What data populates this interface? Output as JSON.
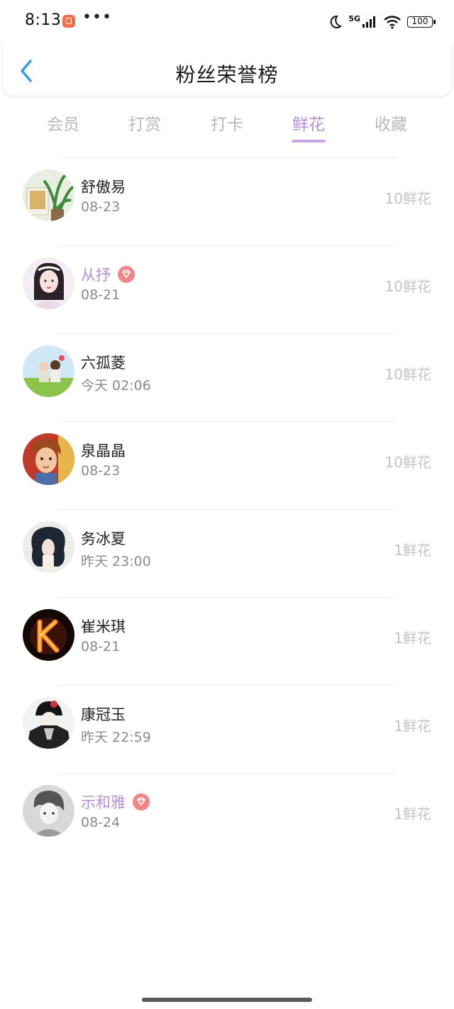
{
  "status_bar": {
    "time": "8:13",
    "dots": "•••",
    "network": "5G",
    "battery": "100"
  },
  "header": {
    "title": "粉丝荣誉榜"
  },
  "tabs": [
    {
      "label": "会员",
      "active": false
    },
    {
      "label": "打赏",
      "active": false
    },
    {
      "label": "打卡",
      "active": false
    },
    {
      "label": "鲜花",
      "active": true
    },
    {
      "label": "收藏",
      "active": false
    }
  ],
  "colors": {
    "accent": "#b98fd3",
    "vip_badge": "#f1858a",
    "muted": "#c4c4c4"
  },
  "list": [
    {
      "name": "舒傲易",
      "date": "08-23",
      "amount": "10鲜花",
      "vip": false,
      "avatar": "plant-photo-avatar"
    },
    {
      "name": "从抒",
      "date": "08-21",
      "amount": "10鲜花",
      "vip": true,
      "avatar": "anime-girl-avatar"
    },
    {
      "name": "六孤菱",
      "date": "今天 02:06",
      "amount": "10鲜花",
      "vip": false,
      "avatar": "couple-on-grass-avatar"
    },
    {
      "name": "泉晶晶",
      "date": "08-23",
      "amount": "10鲜花",
      "vip": false,
      "avatar": "cartoon-boy-avatar"
    },
    {
      "name": "务冰夏",
      "date": "昨天 23:00",
      "amount": "1鲜花",
      "vip": false,
      "avatar": "curly-hair-avatar"
    },
    {
      "name": "崔米琪",
      "date": "08-21",
      "amount": "1鲜花",
      "vip": false,
      "avatar": "fire-letter-k-avatar"
    },
    {
      "name": "康冠玉",
      "date": "昨天 22:59",
      "amount": "1鲜花",
      "vip": false,
      "avatar": "manga-character-avatar"
    },
    {
      "name": "示和雅",
      "date": "08-24",
      "amount": "1鲜花",
      "vip": true,
      "avatar": "sketch-character-avatar"
    }
  ]
}
